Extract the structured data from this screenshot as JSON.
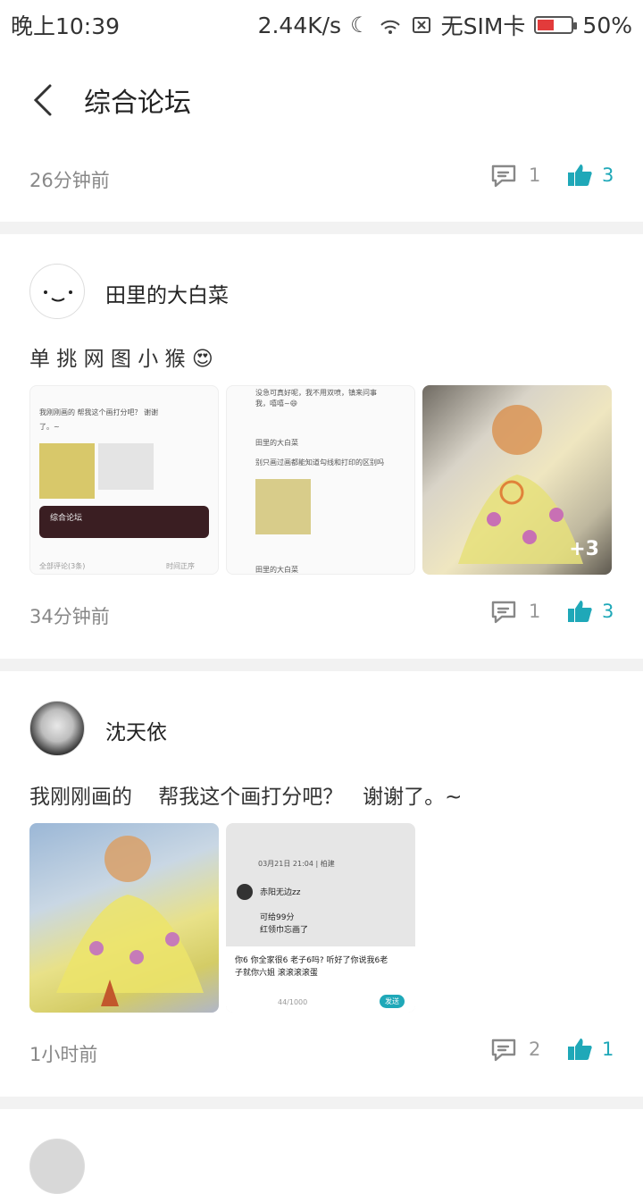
{
  "status_bar": {
    "time": "晚上10:39",
    "network_speed": "2.44K/s",
    "sim_status": "无SIM卡",
    "battery": "50%",
    "battery_level": 0.5,
    "icons": [
      "moon-icon",
      "wifi-icon",
      "no-sim-icon",
      "battery-icon"
    ]
  },
  "header": {
    "title": "综合论坛",
    "back_icon": "chevron-left-icon"
  },
  "post0": {
    "time": "26分钟前",
    "comments": "1",
    "likes": "3"
  },
  "post1": {
    "author": "田里的大白菜",
    "text": "单 挑 网 图 小 猴 😍",
    "time": "34分钟前",
    "comments": "1",
    "likes": "3",
    "more_images": "+3",
    "thumb1_lines": [
      "我刚刚画的   帮我这个画打分吧？   谢谢",
      "了。~",
      "综合论坛",
      "全部评论(3条)",
      "时间正序"
    ],
    "thumb2_lines": [
      "没急可真好呢，我不用双喷，镇来问事",
      "我，嘻嘻~😄",
      "田里的大白菜",
      "别只画过画都能知道勾线和打印的区别吗",
      "田里的大白菜"
    ]
  },
  "post2": {
    "author": "沈天依",
    "text": "我刚刚画的    帮我这个画打分吧？   谢谢了。~",
    "time": "1小时前",
    "comments": "2",
    "likes": "1",
    "thumb2_lines": [
      "03月21日 21:04 | 柏建",
      "赤阳无边zz",
      "可给99分",
      "红领巾忘画了",
      "你6  你全家很6   老子6吗? 听好了你说我6老",
      "子就你六姐          滚滚滚滚蛋",
      "44/1000",
      "发送"
    ]
  },
  "colors": {
    "accent": "#1fa8b8",
    "meta_gray": "#888888",
    "divider": "#f2f2f2"
  }
}
